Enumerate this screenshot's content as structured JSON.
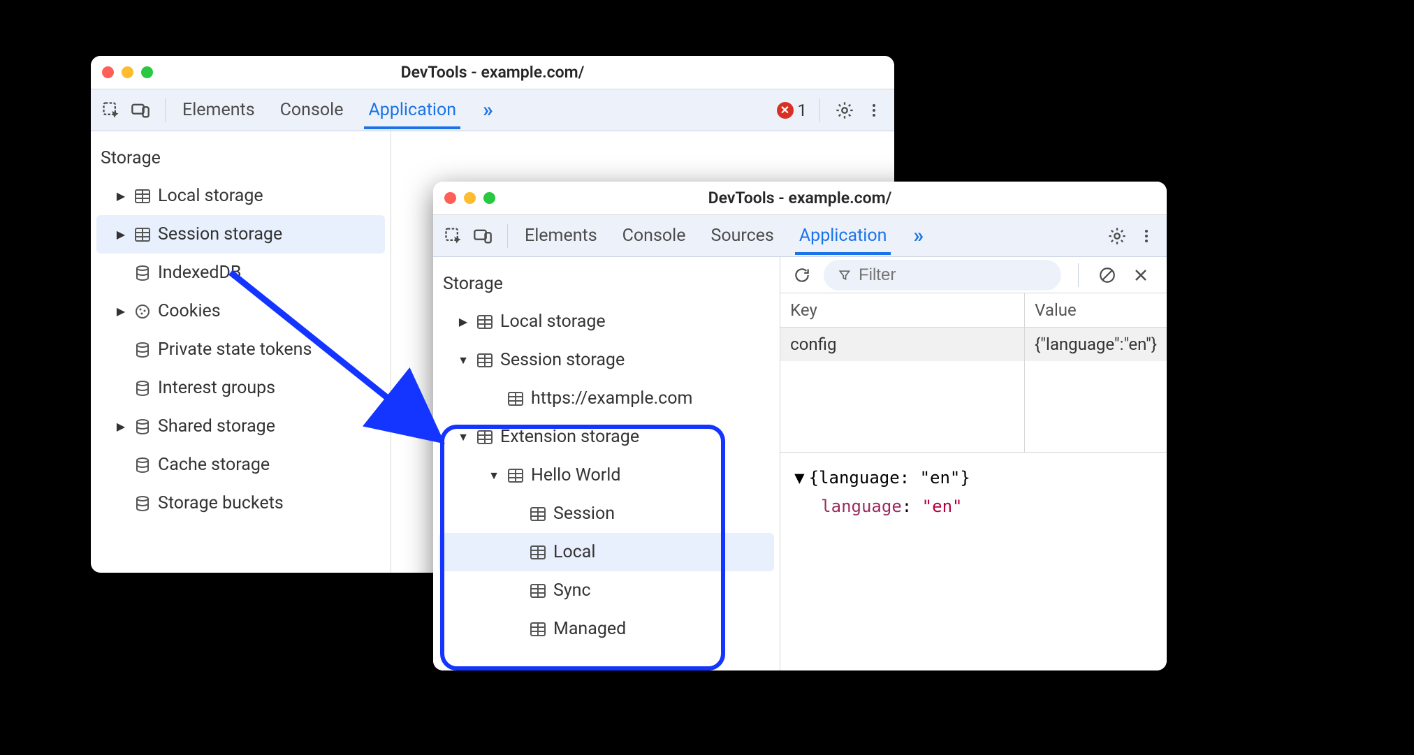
{
  "windowA": {
    "title": "DevTools - example.com/",
    "tabs": {
      "elements": "Elements",
      "console": "Console",
      "application": "Application"
    },
    "errorCount": "1",
    "section": "Storage",
    "tree": {
      "local": "Local storage",
      "session": "Session storage",
      "indexeddb": "IndexedDB",
      "cookies": "Cookies",
      "pst": "Private state tokens",
      "ig": "Interest groups",
      "shared": "Shared storage",
      "cache": "Cache storage",
      "buckets": "Storage buckets"
    }
  },
  "windowB": {
    "title": "DevTools - example.com/",
    "tabs": {
      "elements": "Elements",
      "console": "Console",
      "sources": "Sources",
      "application": "Application"
    },
    "section": "Storage",
    "tree": {
      "local": "Local storage",
      "session": "Session storage",
      "origin": "https://example.com",
      "ext": "Extension storage",
      "hw": "Hello World",
      "s_session": "Session",
      "s_local": "Local",
      "s_sync": "Sync",
      "s_managed": "Managed"
    },
    "filterPlaceholder": "Filter",
    "table": {
      "keyHeader": "Key",
      "valHeader": "Value",
      "rows": [
        {
          "key": "config",
          "value": "{\"language\":\"en\"}"
        }
      ]
    },
    "detail": {
      "summary": "{language: \"en\"}",
      "propKey": "language",
      "propVal": "\"en\""
    }
  }
}
